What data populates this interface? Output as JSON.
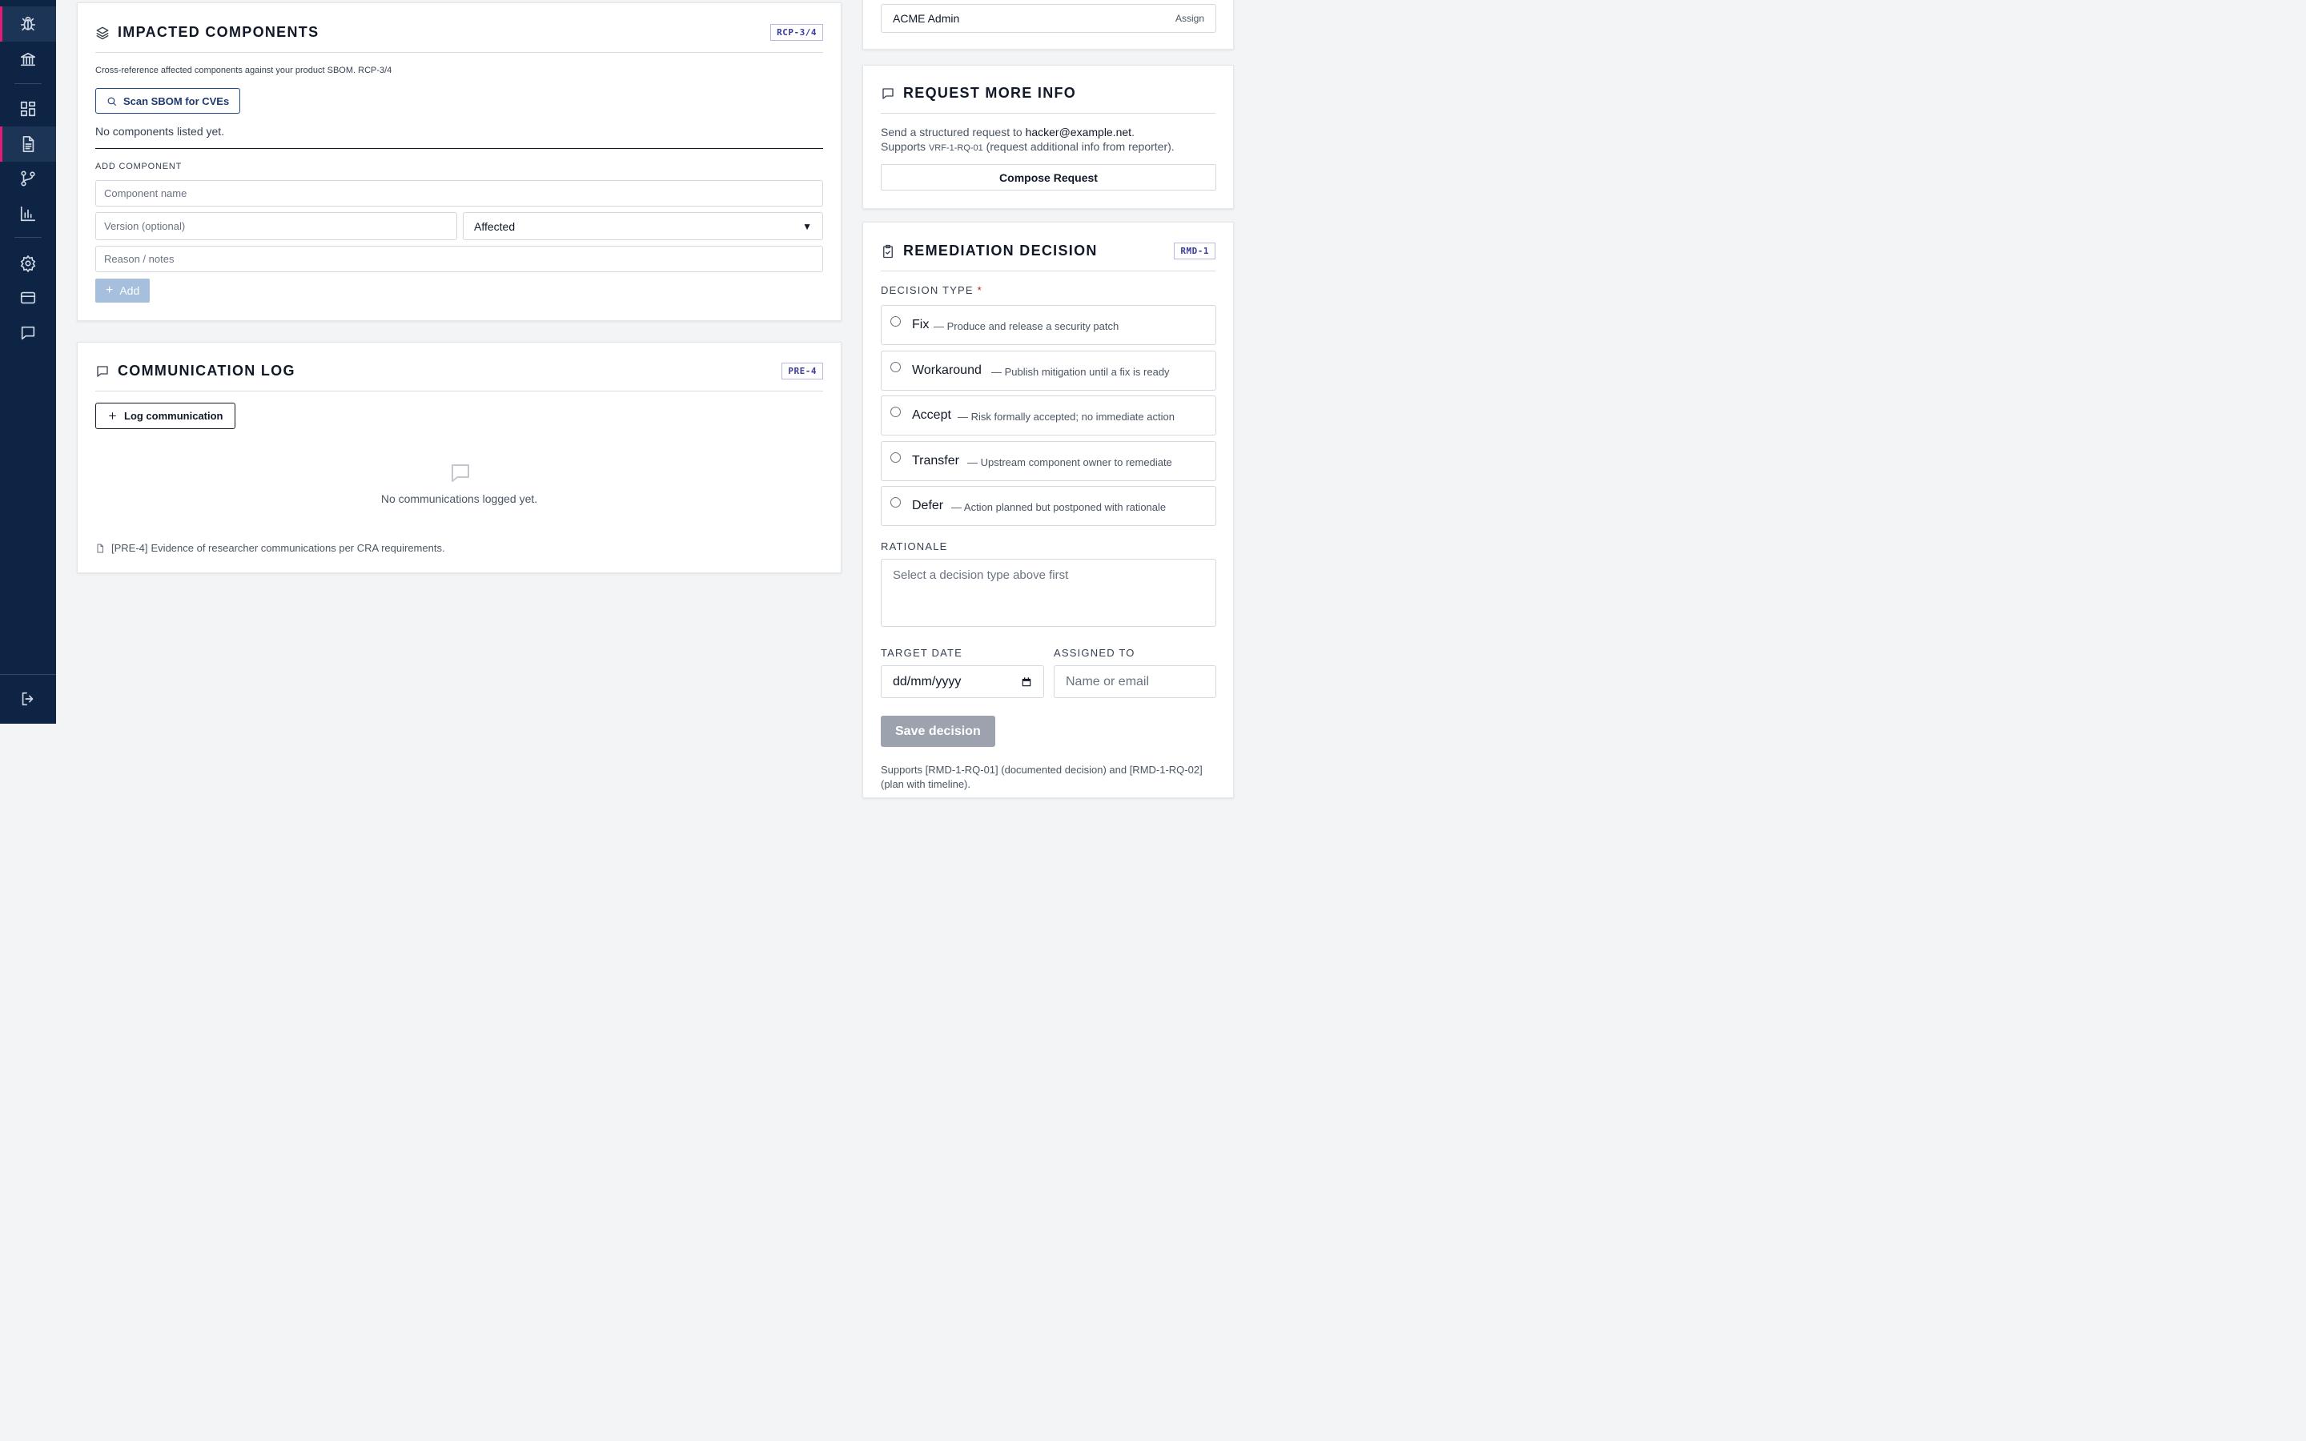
{
  "sidebar": {
    "items": [
      {
        "icon": "bug-icon",
        "name": "sidebar-item-vulnerabilities",
        "active": true
      },
      {
        "icon": "bank-icon",
        "name": "sidebar-item-authorities",
        "active": false
      },
      {
        "icon": "dashboard-icon",
        "name": "sidebar-item-dashboard",
        "active": false
      },
      {
        "icon": "document-icon",
        "name": "sidebar-item-reports",
        "active": true
      },
      {
        "icon": "branch-icon",
        "name": "sidebar-item-workflow",
        "active": false
      },
      {
        "icon": "bar-chart-icon",
        "name": "sidebar-item-analytics",
        "active": false
      },
      {
        "icon": "gear-icon",
        "name": "sidebar-item-settings",
        "active": false
      },
      {
        "icon": "credit-card-icon",
        "name": "sidebar-item-billing",
        "active": false
      },
      {
        "icon": "chat-icon",
        "name": "sidebar-item-messages",
        "active": false
      },
      {
        "icon": "logout-icon",
        "name": "sidebar-item-logout",
        "active": false
      }
    ]
  },
  "impacted": {
    "title": "Impacted Components",
    "badge": "RCP-3/4",
    "description": "Cross-reference affected components against your product SBOM. RCP-3/4",
    "scan_label": "Scan SBOM for CVEs",
    "empty_text": "No components listed yet.",
    "add_heading": "Add component",
    "name_placeholder": "Component name",
    "version_placeholder": "Version (optional)",
    "status_value": "Affected",
    "reason_placeholder": "Reason / notes",
    "add_label": "Add"
  },
  "comm": {
    "title": "Communication Log",
    "badge": "PRE-4",
    "log_label": "Log communication",
    "empty_text": "No communications logged yet.",
    "footnote_code": "[PRE-4]",
    "footnote_text": "Evidence of researcher communications per CRA requirements."
  },
  "assign": {
    "name": "ACME Admin",
    "action": "Assign"
  },
  "request": {
    "title": "Request More Info",
    "line1_prefix": "Send a structured request to",
    "email": "hacker@example.net",
    "line2_prefix": "Supports",
    "code": "VRF-1-RQ-01",
    "line2_suffix": "(request additional info from reporter).",
    "compose_label": "Compose Request"
  },
  "remediation": {
    "title": "Remediation Decision",
    "badge": "RMD-1",
    "decision_label": "Decision type",
    "required_mark": "*",
    "options": [
      {
        "name": "Fix",
        "desc": "— Produce and release a security patch"
      },
      {
        "name": "Workaround",
        "desc": "— Publish mitigation until a fix is ready"
      },
      {
        "name": "Accept",
        "desc": "— Risk formally accepted; no immediate action"
      },
      {
        "name": "Transfer",
        "desc": "— Upstream component owner to remediate"
      },
      {
        "name": "Defer",
        "desc": "— Action planned but postponed with rationale"
      }
    ],
    "rationale_label": "Rationale",
    "rationale_placeholder": "Select a decision type above first",
    "target_date_label": "Target date",
    "target_date_placeholder": "dd/mm/yyyy",
    "assigned_label": "Assigned to",
    "assigned_placeholder": "Name or email",
    "save_label": "Save decision",
    "footnote": "Supports [RMD-1-RQ-01] (documented decision) and [RMD-1-RQ-02] (plan with timeline)."
  }
}
